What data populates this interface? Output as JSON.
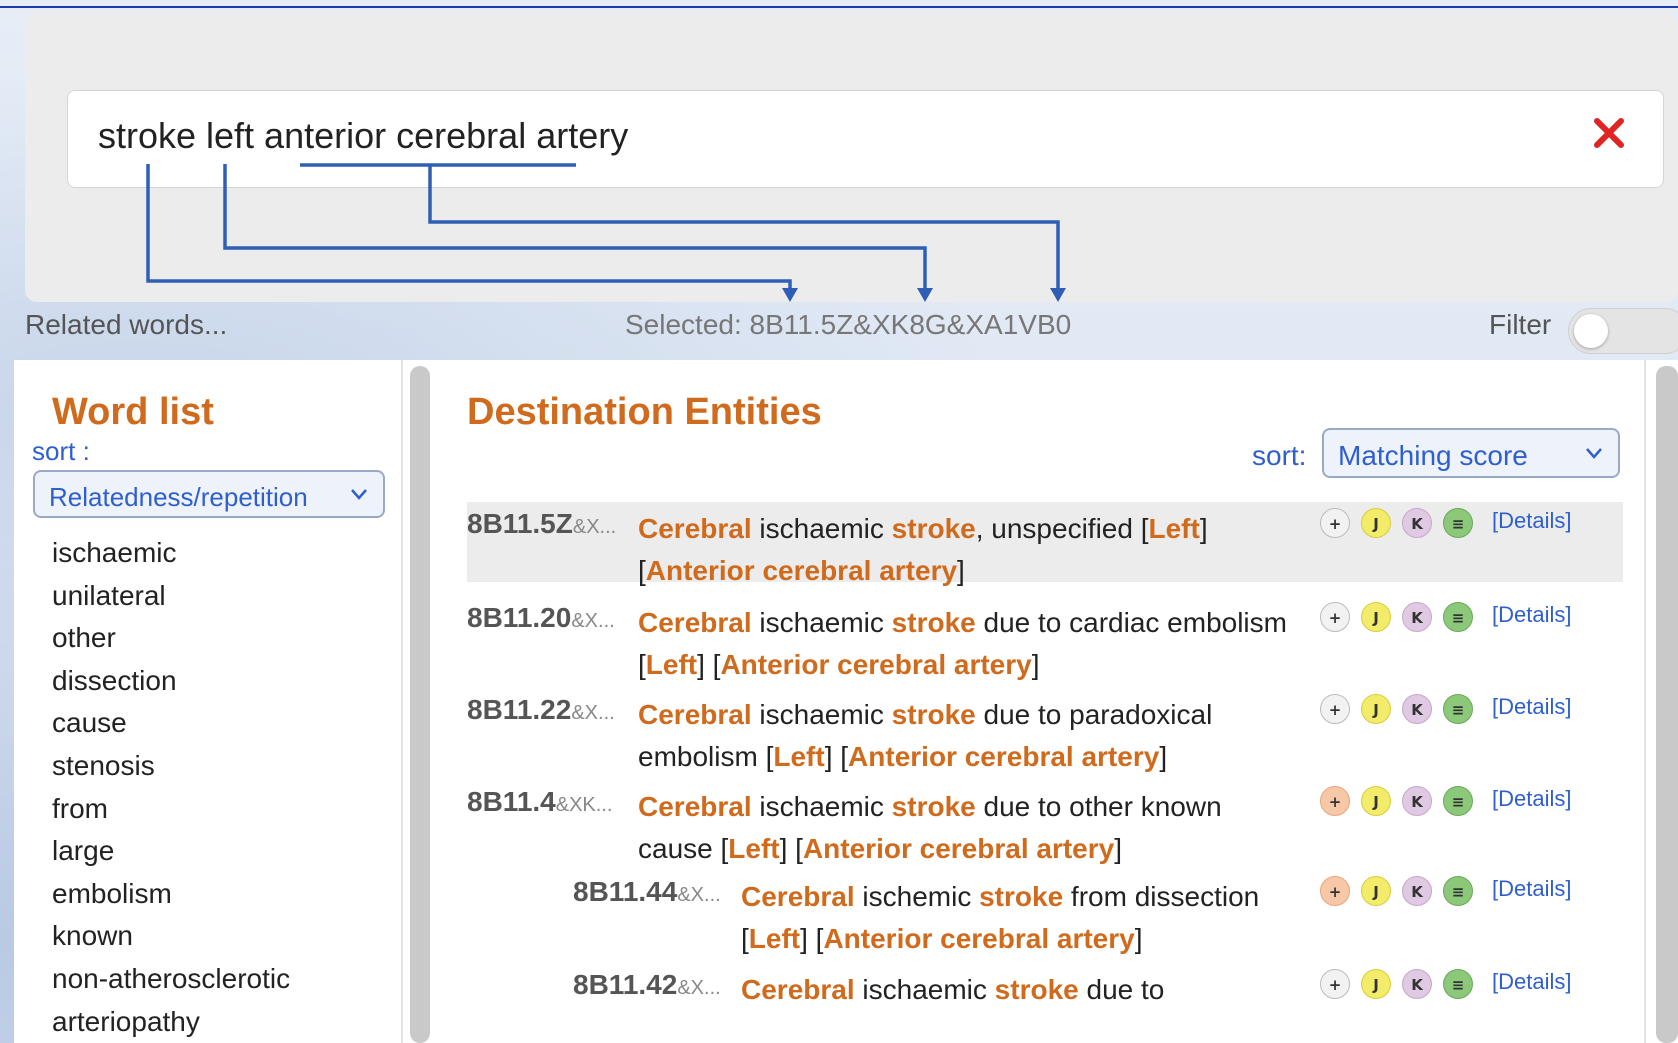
{
  "search": {
    "query": "stroke left anterior cerebral artery"
  },
  "status": {
    "related_words": "Related words...",
    "selected": "Selected: 8B11.5Z&XK8G&XA1VB0",
    "filter_label": "Filter"
  },
  "word_list": {
    "title": "Word list",
    "sort_label": "sort :",
    "sort_value": "Relatedness/repetition",
    "items": [
      "ischaemic",
      "unilateral",
      "other",
      "dissection",
      "cause",
      "stenosis",
      "from",
      "large",
      "embolism",
      "known",
      "non-atherosclerotic",
      "arteriopathy"
    ]
  },
  "destination": {
    "title": "Destination Entities",
    "sort_label": "sort:",
    "sort_value": "Matching score",
    "details_label": "[Details]",
    "icon_labels": {
      "plus": "+",
      "j": "J",
      "k": "K",
      "list": "≡"
    },
    "entities": [
      {
        "code": "8B11.5Z",
        "ext": "&X...",
        "line1": [
          [
            "Cerebral",
            1
          ],
          [
            " ischaemic ",
            0
          ],
          [
            "stroke",
            1
          ],
          [
            ", unspecified [",
            0
          ],
          [
            "Left",
            1
          ],
          [
            "]",
            0
          ]
        ],
        "line2": [
          [
            "[",
            0
          ],
          [
            "Anterior cerebral artery",
            1
          ],
          [
            "]",
            0
          ]
        ]
      },
      {
        "code": "8B11.20",
        "ext": "&X...",
        "line1": [
          [
            "Cerebral",
            1
          ],
          [
            " ischaemic ",
            0
          ],
          [
            "stroke",
            1
          ],
          [
            " due to cardiac embolism",
            0
          ]
        ],
        "line2": [
          [
            "[",
            0
          ],
          [
            "Left",
            1
          ],
          [
            "] [",
            0
          ],
          [
            "Anterior cerebral artery",
            1
          ],
          [
            "]",
            0
          ]
        ]
      },
      {
        "code": "8B11.22",
        "ext": "&X...",
        "line1": [
          [
            "Cerebral",
            1
          ],
          [
            " ischaemic ",
            0
          ],
          [
            "stroke",
            1
          ],
          [
            " due to paradoxical",
            0
          ]
        ],
        "line2": [
          [
            "embolism [",
            0
          ],
          [
            "Left",
            1
          ],
          [
            "] [",
            0
          ],
          [
            "Anterior cerebral artery",
            1
          ],
          [
            "]",
            0
          ]
        ]
      },
      {
        "code": "8B11.4",
        "ext": "&XK...",
        "line1": [
          [
            "Cerebral",
            1
          ],
          [
            " ischaemic ",
            0
          ],
          [
            "stroke",
            1
          ],
          [
            " due to other known",
            0
          ]
        ],
        "line2": [
          [
            "cause [",
            0
          ],
          [
            "Left",
            1
          ],
          [
            "] [",
            0
          ],
          [
            "Anterior cerebral artery",
            1
          ],
          [
            "]",
            0
          ]
        ]
      },
      {
        "code": "8B11.44",
        "ext": "&X...",
        "line1": [
          [
            "Cerebral",
            1
          ],
          [
            " ischemic ",
            0
          ],
          [
            "stroke",
            1
          ],
          [
            " from dissection",
            0
          ]
        ],
        "line2": [
          [
            "[",
            0
          ],
          [
            "Left",
            1
          ],
          [
            "] [",
            0
          ],
          [
            "Anterior cerebral artery",
            1
          ],
          [
            "]",
            0
          ]
        ]
      },
      {
        "code": "8B11.42",
        "ext": "&X...",
        "line1": [
          [
            "Cerebral",
            1
          ],
          [
            " ischaemic ",
            0
          ],
          [
            "stroke",
            1
          ],
          [
            " due to",
            0
          ]
        ],
        "line2": []
      }
    ]
  }
}
